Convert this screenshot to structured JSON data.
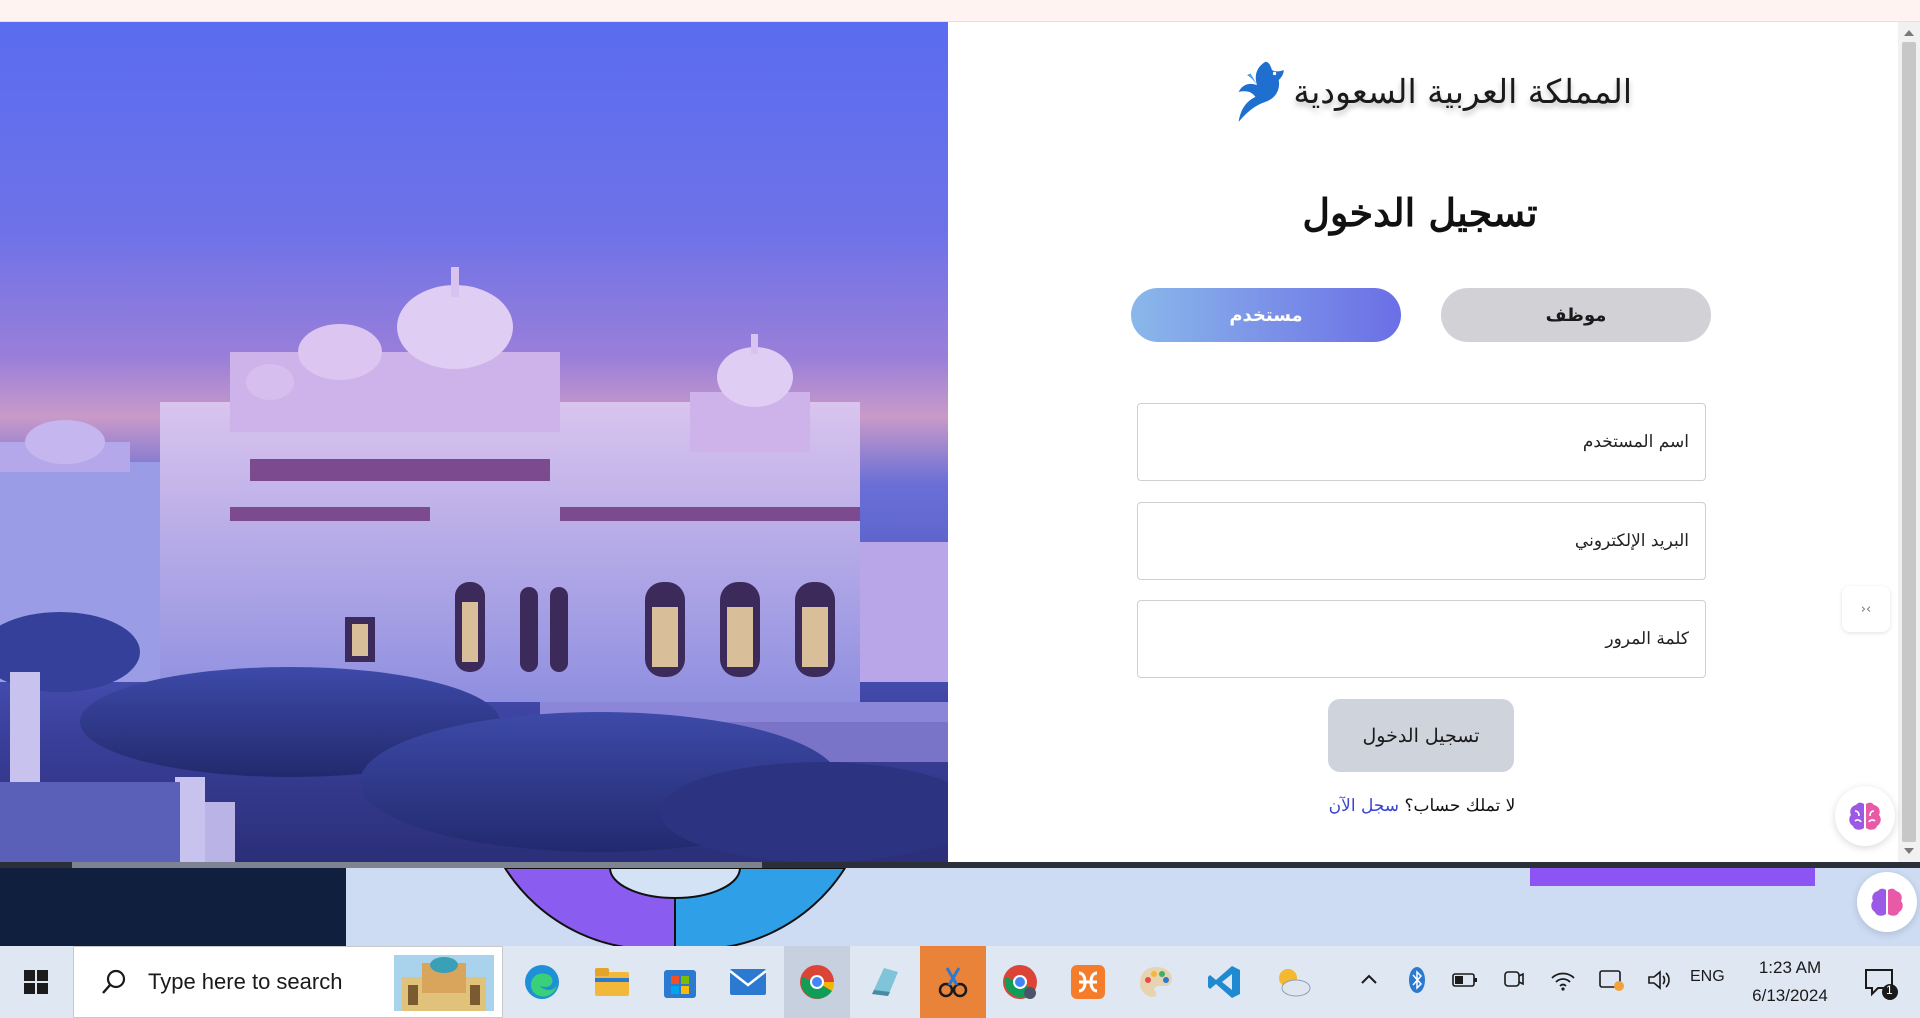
{
  "brand": {
    "name": "المملكة العربية السعودية",
    "accent": "#1e6fd0"
  },
  "login": {
    "title": "تسجيل الدخول",
    "tabs": {
      "user": "مستخدم",
      "employee": "موظف"
    },
    "fields": {
      "username_placeholder": "اسم المستخدم",
      "email_placeholder": "البريد الإلكتروني",
      "password_placeholder": "كلمة المرور"
    },
    "submit_label": "تسجيل الدخول",
    "signup_prompt": "لا تملك حساب؟",
    "signup_link": "سجل الآن",
    "active_tab_colors": [
      "#8ab8ea",
      "#6b6fe6"
    ]
  },
  "side_tools": {
    "toggle_icon": "code-toggle-icon",
    "toggle_glyph": "›‹",
    "assistant_icon": "brain-icon"
  },
  "taskbar": {
    "search_placeholder": "Type here to search",
    "apps": [
      "edge-icon",
      "file-explorer-icon",
      "microsoft-store-icon",
      "mail-icon",
      "chrome-icon",
      "notepad-icon",
      "snipping-tool-icon",
      "chrome-profile-icon",
      "xampp-icon",
      "paint-icon",
      "vscode-icon",
      "weather-icon"
    ],
    "tray": {
      "language": "ENG",
      "time": "1:23 AM",
      "date": "6/13/2024",
      "notification_count": "1"
    }
  }
}
